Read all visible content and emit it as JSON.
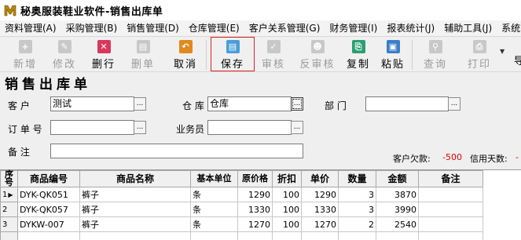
{
  "window": {
    "title": "秘奥服装鞋业软件-销售出库单"
  },
  "menu": [
    "资料管理(A)",
    "采购管理(B)",
    "销售管理(D)",
    "仓库管理(E)",
    "客户关系管理(G)",
    "财务管理(I)",
    "报表统计(J)",
    "辅助工具(J)",
    "系统管理"
  ],
  "toolbar": {
    "new": "新增",
    "edit": "修改",
    "delete_row": "删行",
    "delete_doc": "删单",
    "cancel": "取消",
    "save": "保存",
    "audit": "审核",
    "unaudit": "反审核",
    "copy": "复制",
    "paste": "粘贴",
    "query": "查询",
    "print": "打印",
    "more": "导"
  },
  "colors": {
    "accent_red": "#e00000",
    "highlight_box": "#e02020"
  },
  "form": {
    "title": "销售出库单",
    "customer_label": "客    户",
    "customer_value": "测试",
    "warehouse_label": "仓  库",
    "warehouse_value": "仓库",
    "dept_label": "部      门",
    "dept_value": "",
    "order_label": "订 单 号",
    "order_value": "",
    "salesman_label": "业务员",
    "salesman_value": "",
    "remark_label": "备    注",
    "remark_value": "",
    "ellipsis": "...",
    "debt_label": "客户欠款:",
    "debt_value": "-500",
    "credit_label": "信用天数:",
    "credit_value": "-"
  },
  "table": {
    "headers": [
      "序号",
      "商品编号",
      "商品名称",
      "基本单位",
      "原价格",
      "折扣",
      "单价",
      "数量",
      "金额",
      "备注"
    ],
    "rows": [
      {
        "no": "1",
        "code": "DYK-QK051",
        "name": "裤子",
        "unit": "条",
        "orig": "1290",
        "disc": "100",
        "price": "1290",
        "qty": "3",
        "amount": "3870",
        "remark": ""
      },
      {
        "no": "2",
        "code": "DYK-QK057",
        "name": "裤子",
        "unit": "条",
        "orig": "1330",
        "disc": "100",
        "price": "1330",
        "qty": "3",
        "amount": "3990",
        "remark": ""
      },
      {
        "no": "3",
        "code": "DYKW-007",
        "name": "裤子",
        "unit": "条",
        "orig": "1270",
        "disc": "100",
        "price": "1270",
        "qty": "2",
        "amount": "2540",
        "remark": ""
      },
      {
        "no": "",
        "code": "",
        "name": "",
        "unit": "",
        "orig": "",
        "disc": "",
        "price": "",
        "qty": "",
        "amount": "",
        "remark": ""
      }
    ]
  }
}
